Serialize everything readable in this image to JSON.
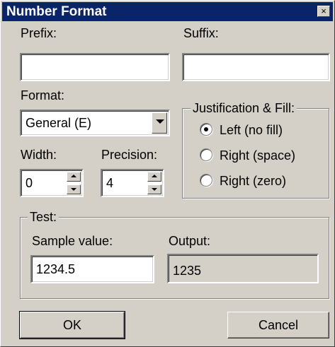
{
  "window": {
    "title": "Number Format",
    "close_glyph": "×"
  },
  "prefix": {
    "label": "Prefix:",
    "value": ""
  },
  "suffix": {
    "label": "Suffix:",
    "value": ""
  },
  "format": {
    "label": "Format:",
    "selected": "General (E)"
  },
  "width": {
    "label": "Width:",
    "value": "0"
  },
  "precision": {
    "label": "Precision:",
    "value": "4"
  },
  "justification": {
    "legend": "Justification & Fill:",
    "options": [
      {
        "label": "Left (no fill)",
        "selected": true
      },
      {
        "label": "Right (space)",
        "selected": false
      },
      {
        "label": "Right (zero)",
        "selected": false
      }
    ]
  },
  "test": {
    "legend": "Test:",
    "sample_label": "Sample value:",
    "sample_value": "1234.5",
    "output_label": "Output:",
    "output_value": "1235"
  },
  "buttons": {
    "ok": "OK",
    "cancel": "Cancel"
  },
  "colors": {
    "face": "#d4d0c8",
    "titlebar": "#0a246a",
    "title_text": "#ffffff"
  }
}
